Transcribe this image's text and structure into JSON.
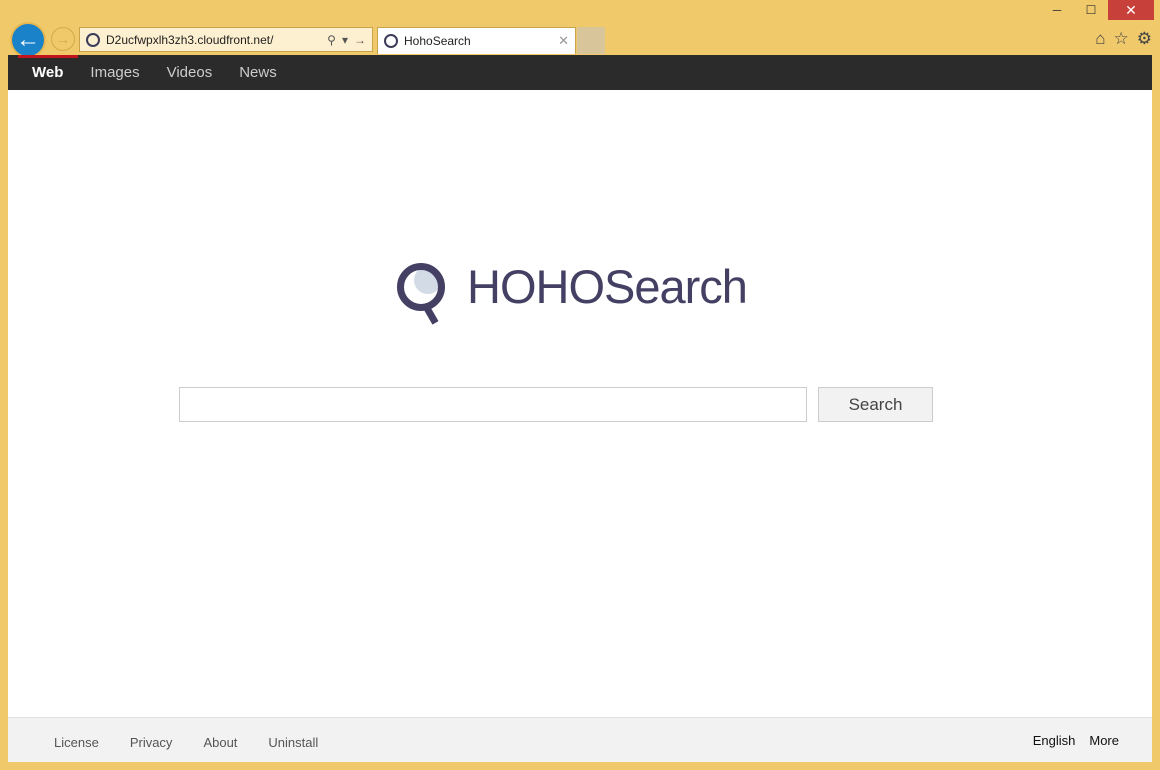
{
  "browser": {
    "address": "D2ucfwpxlh3zh3.cloudfront.net/",
    "tab_title": "HohoSearch",
    "window_controls": {
      "minimize": "─",
      "maximize": "☐",
      "close": "✕"
    }
  },
  "nav": {
    "items": [
      {
        "label": "Web",
        "active": true
      },
      {
        "label": "Images"
      },
      {
        "label": "Videos"
      },
      {
        "label": "News"
      }
    ]
  },
  "logo": {
    "text": "HOHOSearch",
    "color": "#434063"
  },
  "search": {
    "placeholder": "",
    "button": "Search"
  },
  "footer": {
    "links": [
      "License",
      "Privacy",
      "About",
      "Uninstall"
    ],
    "right": [
      "English",
      "More"
    ]
  }
}
